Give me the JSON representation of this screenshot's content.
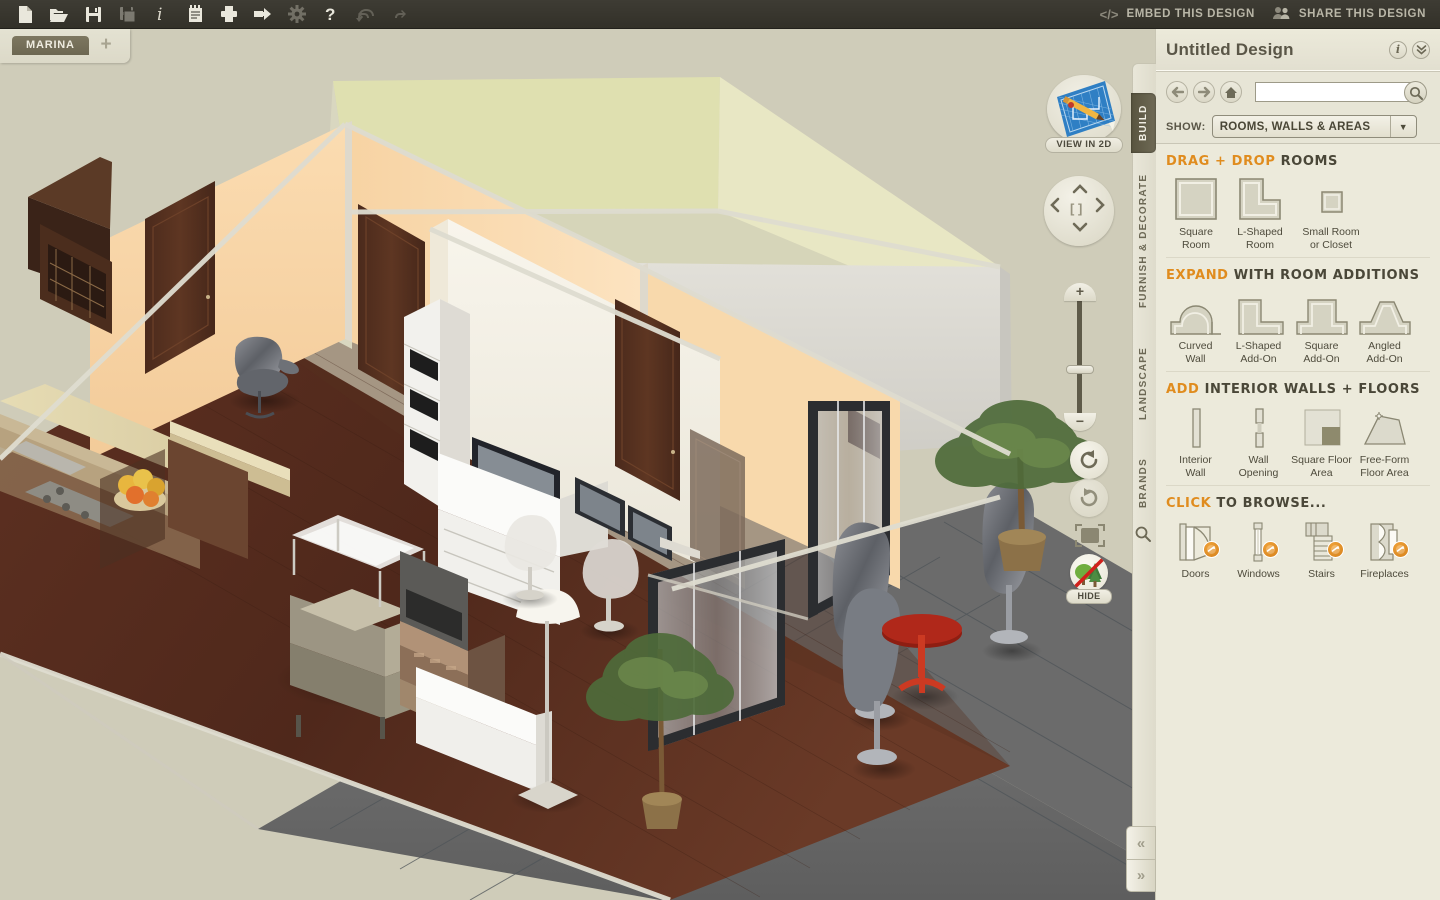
{
  "toolbar": {
    "left_buttons": [
      {
        "name": "new-document-icon",
        "label": "New"
      },
      {
        "name": "open-folder-icon",
        "label": "Open"
      },
      {
        "name": "save-icon",
        "label": "Save"
      },
      {
        "name": "save-as-icon",
        "label": "Save As"
      },
      {
        "name": "info-icon",
        "label": "Info"
      },
      {
        "name": "notes-icon",
        "label": "Notes"
      },
      {
        "name": "print-icon",
        "label": "Print"
      },
      {
        "name": "export-icon",
        "label": "Export"
      },
      {
        "name": "settings-gear-icon",
        "label": "Settings"
      },
      {
        "name": "help-icon",
        "label": "Help"
      },
      {
        "name": "undo-icon",
        "label": "Undo"
      },
      {
        "name": "redo-icon",
        "label": "Redo"
      }
    ],
    "embed_label": "EMBED THIS DESIGN",
    "embed_glyph": "</>",
    "share_label": "SHARE THIS DESIGN"
  },
  "tabs": {
    "project_tab": "MARINA",
    "add_tab": "+"
  },
  "viewport": {
    "view_2d_label": "VIEW IN 2D",
    "hide_label": "HIDE",
    "pad_up": "⌃",
    "pad_down": "⌄",
    "pad_left": "‹",
    "pad_right": "›",
    "pad_center": "[ ]",
    "zoom_in": "+",
    "zoom_out": "−"
  },
  "rail": {
    "tabs": [
      {
        "label": "BUILD",
        "active": true
      },
      {
        "label": "FURNISH & DECORATE",
        "active": false
      },
      {
        "label": "LANDSCAPE",
        "active": false
      },
      {
        "label": "BRANDS",
        "active": false
      }
    ],
    "search_icon": "search-icon"
  },
  "collapse": {
    "prev": "«",
    "next": "»"
  },
  "panel": {
    "title": "Untitled Design",
    "info_glyph": "i",
    "collapse_glyph": "»",
    "search": {
      "value": "",
      "placeholder": ""
    },
    "show": {
      "label": "SHOW:",
      "value": "ROOMS, WALLS & AREAS",
      "caret": "▼"
    },
    "sections": [
      {
        "id": "drag-drop-rooms",
        "accent_text": "DRAG + DROP",
        "rest_text": " ROOMS",
        "items": [
          {
            "name": "square-room",
            "label": "Square\nRoom",
            "label_lines": [
              "Square",
              "Room"
            ]
          },
          {
            "name": "l-shaped-room",
            "label_lines": [
              "L-Shaped",
              "Room"
            ]
          },
          {
            "name": "small-room-or-closet",
            "label_lines": [
              "Small Room",
              "or Closet"
            ]
          }
        ]
      },
      {
        "id": "room-additions",
        "accent_text": "EXPAND",
        "rest_text": " WITH ROOM ADDITIONS",
        "items": [
          {
            "name": "curved-wall",
            "label_lines": [
              "Curved",
              "Wall"
            ]
          },
          {
            "name": "l-shaped-add-on",
            "label_lines": [
              "L-Shaped",
              "Add-On"
            ]
          },
          {
            "name": "square-add-on",
            "label_lines": [
              "Square",
              "Add-On"
            ]
          },
          {
            "name": "angled-add-on",
            "label_lines": [
              "Angled",
              "Add-On"
            ]
          }
        ]
      },
      {
        "id": "interior-walls-floors",
        "accent_text": "ADD",
        "rest_text": " INTERIOR WALLS + FLOORS",
        "items": [
          {
            "name": "interior-wall",
            "label_lines": [
              "Interior",
              "Wall"
            ]
          },
          {
            "name": "wall-opening",
            "label_lines": [
              "Wall",
              "Opening"
            ]
          },
          {
            "name": "square-floor-area",
            "label_lines": [
              "Square Floor",
              "Area"
            ]
          },
          {
            "name": "free-form-floor-area",
            "label_lines": [
              "Free-Form",
              "Floor Area"
            ]
          }
        ]
      },
      {
        "id": "click-to-browse",
        "accent_text": "CLICK",
        "rest_text": " TO BROWSE...",
        "items": [
          {
            "name": "doors",
            "label_lines": [
              "Doors"
            ]
          },
          {
            "name": "windows",
            "label_lines": [
              "Windows"
            ]
          },
          {
            "name": "stairs",
            "label_lines": [
              "Stairs"
            ]
          },
          {
            "name": "fireplaces",
            "label_lines": [
              "Fireplaces"
            ]
          }
        ]
      }
    ]
  },
  "colors": {
    "accent_orange": "#e08c1e",
    "toolbar_dark": "#38362e",
    "panel_bg": "#eceadb",
    "canvas_bg": "#cfccb9",
    "wall_peach": "#f6d3a4",
    "wall_olive": "#dfe0b0",
    "wall_white": "#f4f1e7",
    "floor_wood": "#5a2f20",
    "balcony_tile": "#6e6e6e",
    "tab_active": "#6d6752"
  }
}
